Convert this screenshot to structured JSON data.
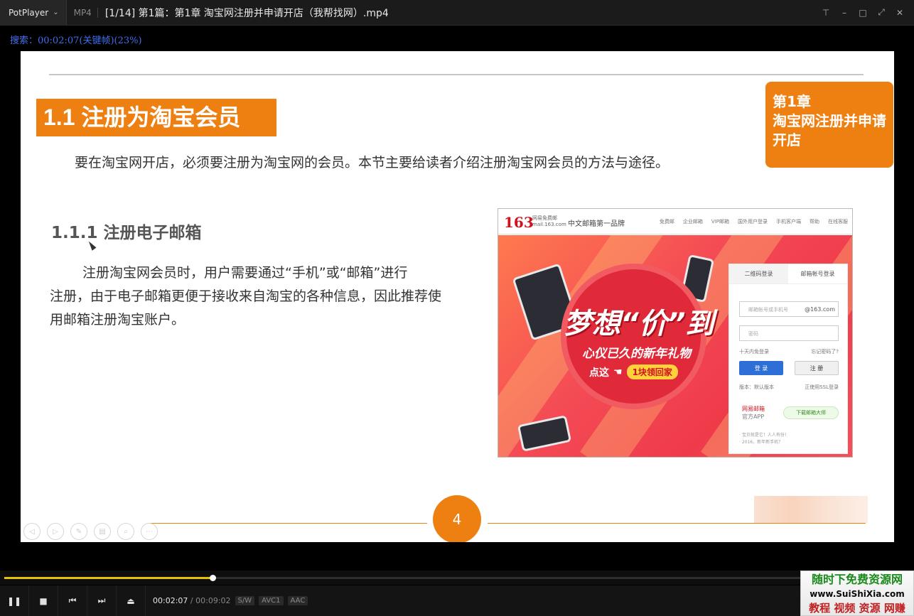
{
  "titlebar": {
    "app_name": "PotPlayer",
    "format": "MP4",
    "file_title": "[1/14] 第1篇：第1章 淘宝网注册并申请开店（我帮找网）.mp4"
  },
  "seek_osd": "搜索：00:02:07(关键帧)(23%)",
  "slide": {
    "section_title": "1.1 注册为淘宝会员",
    "chapter_label": "第1章",
    "chapter_title_line1": "淘宝网注册并申请",
    "chapter_title_line2": "开店",
    "intro": "要在淘宝网开店，必须要注册为淘宝网的会员。本节主要给读者介绍注册淘宝网会员的方法与途径。",
    "subheading": "1.1.1 注册电子邮箱",
    "body_lines": [
      "注册淘宝网会员时，用户需要通过“手机”或“邮箱”进行",
      "注册，由于电子邮箱更便于接收来自淘宝的各种信息，因此推荐使",
      "用邮箱注册淘宝账户。"
    ],
    "page_number": "4"
  },
  "mail_screenshot": {
    "logo": "163",
    "logo_sub_line1": "网易免费邮",
    "logo_sub_line2": "mail.163.com",
    "slogan": "中文邮箱第一品牌",
    "nav": [
      "免费邮",
      "企业邮箱",
      "VIP邮箱",
      "国外用户登录",
      "手机客户端",
      "帮助",
      "在线客服"
    ],
    "headline": "梦想“价”到",
    "subline": "心仪已久的新年礼物",
    "cta_label": "点这",
    "cta_pill": "1块领回家",
    "tab_qr": "二维码登录",
    "tab_account": "邮箱帐号登录",
    "account_placeholder": "邮箱帐号或手机号",
    "account_suffix": "@163.com",
    "password_placeholder": "密码",
    "remember": "十天内免登录",
    "forgot": "忘记密码了?",
    "login_button": "登 录",
    "register_button": "注 册",
    "version": "版本：默认版本",
    "ssl": "正使用SSL登录",
    "app_name": "网易邮箱",
    "app_sub": "官方APP",
    "download": "下载邮箱大师",
    "footer_line1": "· 宝贝就是它！人人有份！",
    "footer_line2": "· 2016，新年新手机？"
  },
  "player": {
    "progress_fraction": 0.23,
    "current_time": "00:02:07",
    "separator": "/",
    "total_time": "00:09:02",
    "badges": [
      "S/W",
      "AVC1",
      "AAC"
    ]
  },
  "watermark": {
    "line1": "随时下免费资源网",
    "line2": "www.SuiShiXia.com",
    "line3": "教程 视频 资源 网赚"
  },
  "colors": {
    "accent_orange": "#ee8012",
    "osd_blue": "#3f6ff0",
    "seek_fill": "#e6c200"
  }
}
